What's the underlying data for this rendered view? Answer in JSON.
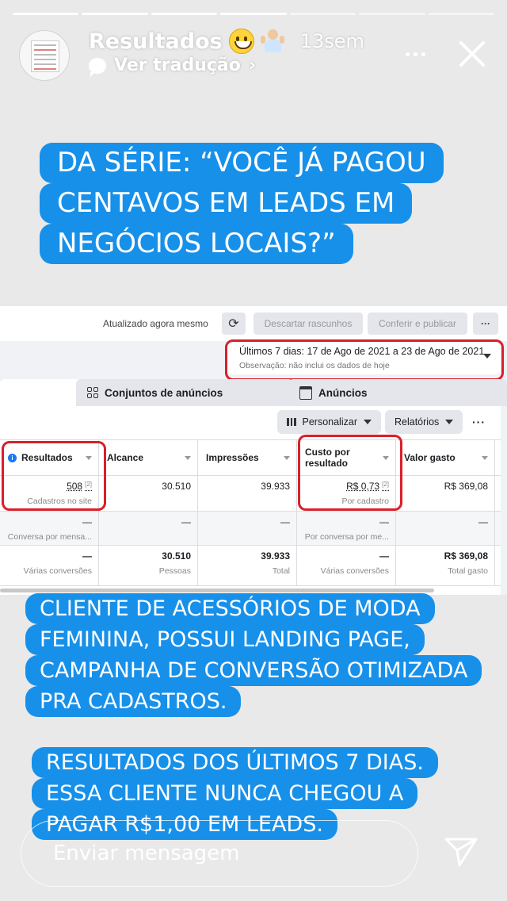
{
  "story": {
    "progress_total": 7,
    "progress_done": 4,
    "username": "Resultados",
    "emojis": [
      "grinning-face-emoji",
      "man-shrugging-emoji"
    ],
    "time": "13sem",
    "translate_label": "Ver tradução",
    "chevron": "›"
  },
  "captions": {
    "top": [
      "DA SÉRIE: “VOCÊ JÁ PAGOU",
      "CENTAVOS EM LEADS EM",
      "NEGÓCIOS LOCAIS?”"
    ],
    "middle": [
      "CLIENTE DE ACESSÓRIOS DE MODA",
      "FEMININA, POSSUI LANDING PAGE,",
      "CAMPANHA DE CONVERSÃO OTIMIZADA",
      "PRA CADASTROS."
    ],
    "bottom": [
      "RESULTADOS DOS ÚLTIMOS 7 DIAS.",
      "ESSA CLIENTE NUNCA CHEGOU A",
      "PAGAR R$1,00 EM LEADS."
    ]
  },
  "ads_manager": {
    "updated_text": "Atualizado agora mesmo",
    "discard_label": "Descartar rascunhos",
    "publish_label": "Conferir e publicar",
    "more_label": "···",
    "date_range": "Últimos 7 dias: 17 de Ago de 2021 a 23 de Ago de 2021",
    "date_note": "Observação: não inclui os dados de hoje",
    "tabs": {
      "ad_sets": "Conjuntos de anúncios",
      "ads": "Anúncios"
    },
    "customize_label": "Personalizar",
    "reports_label": "Relatórios",
    "columns": [
      "Resultados",
      "Alcance",
      "Impressões",
      "Custo por resultado",
      "Valor gasto"
    ],
    "row1": [
      {
        "value": "508",
        "sub": "Cadastros no site",
        "sup": "[2]"
      },
      {
        "value": "30.510",
        "sub": ""
      },
      {
        "value": "39.933",
        "sub": ""
      },
      {
        "value": "R$ 0,73",
        "sub": "Por cadastro",
        "sup": "[2]"
      },
      {
        "value": "R$ 369,08",
        "sub": ""
      }
    ],
    "row2": [
      {
        "value": "—",
        "sub": "Conversa por mensa..."
      },
      {
        "value": "—",
        "sub": ""
      },
      {
        "value": "—",
        "sub": ""
      },
      {
        "value": "—",
        "sub": "Por conversa por me..."
      },
      {
        "value": "—",
        "sub": ""
      }
    ],
    "row3": [
      {
        "value": "—",
        "sub": "Várias conversões"
      },
      {
        "value": "30.510",
        "sub": "Pessoas"
      },
      {
        "value": "39.933",
        "sub": "Total"
      },
      {
        "value": "—",
        "sub": "Várias conversões"
      },
      {
        "value": "R$ 369,08",
        "sub": "Total gasto"
      }
    ],
    "highlight_color": "#d8202b"
  },
  "composer": {
    "placeholder": "Enviar mensagem"
  },
  "colors": {
    "caption_bg": "#1790ea",
    "accent": "#1877f2"
  }
}
